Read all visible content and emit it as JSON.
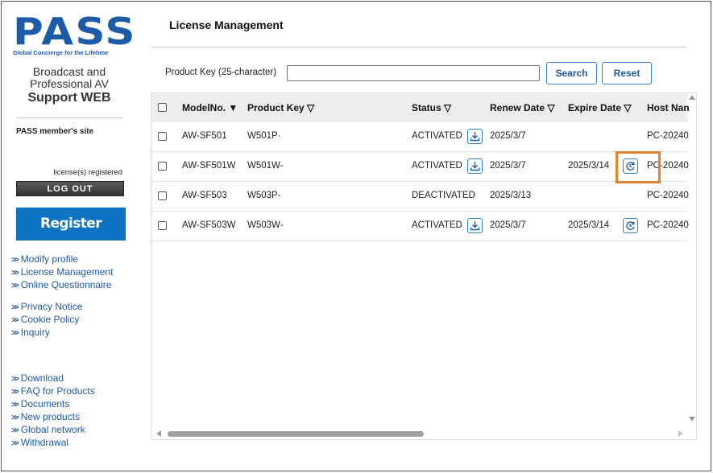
{
  "brand": {
    "logo": "PASS",
    "tagline": "Global Concierge for the Lifetime",
    "site_title": "Broadcast and Professional AV",
    "site_title_strong": "Support WEB"
  },
  "sidebar": {
    "member_site": "PASS member's site",
    "registered": "license(s) registered",
    "logout": "LOG OUT",
    "register": "Register product",
    "nav_group_1": [
      "Modify profile",
      "License Management",
      "Online Questionnaire"
    ],
    "nav_group_2": [
      "Privacy Notice",
      "Cookie Policy",
      "Inquiry"
    ],
    "nav_group_3": [
      "Download",
      "FAQ for Products",
      "Documents",
      "New products",
      "Global network",
      "Withdrawal"
    ]
  },
  "main": {
    "title": "License Management",
    "search": {
      "label": "Product Key (25-character)",
      "value": "",
      "search_button": "Search",
      "reset_button": "Reset"
    },
    "table": {
      "columns": [
        "ModelNo. ▼",
        "Product Key ▽",
        "Status ▽",
        "Renew Date ▽",
        "Expire Date ▽",
        "Host Nan"
      ],
      "rows": [
        {
          "model": "AW-SF501",
          "key": "W501P·",
          "status": "ACTIVATED",
          "renew": "2025/3/7",
          "expire": "",
          "host": "PC-20240",
          "download_icon": true,
          "renew_icon": false
        },
        {
          "model": "AW-SF501W",
          "key": "W501W-",
          "status": "ACTIVATED",
          "renew": "2025/3/7",
          "expire": "2025/3/14",
          "host": "PC-20240",
          "download_icon": true,
          "renew_icon": true
        },
        {
          "model": "AW-SF503",
          "key": "W503P-",
          "status": "DEACTIVATED",
          "renew": "2025/3/13",
          "expire": "",
          "host": "PC-20240",
          "download_icon": false,
          "renew_icon": false
        },
        {
          "model": "AW-SF503W",
          "key": "W503W-",
          "status": "ACTIVATED",
          "renew": "2025/3/7",
          "expire": "2025/3/14",
          "host": "PC-20240",
          "download_icon": true,
          "renew_icon": true
        }
      ]
    }
  },
  "colors": {
    "brand_blue": "#1d5aa8",
    "register_blue": "#0f73c4",
    "highlight_orange": "#e8822e"
  },
  "icons": [
    "download-icon",
    "renew-license-icon",
    "chevron-double-right-icon"
  ]
}
